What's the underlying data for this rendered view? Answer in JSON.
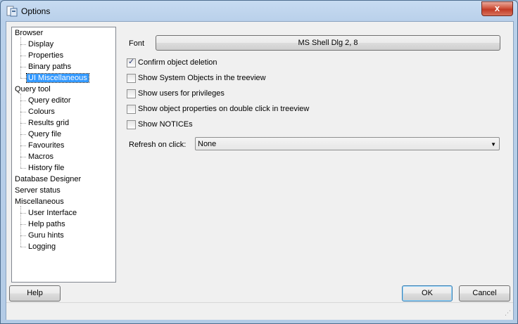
{
  "window": {
    "title": "Options",
    "close_glyph": "x"
  },
  "tree": {
    "items": [
      {
        "label": "Browser",
        "level": 0
      },
      {
        "label": "Display",
        "level": 1
      },
      {
        "label": "Properties",
        "level": 1
      },
      {
        "label": "Binary paths",
        "level": 1
      },
      {
        "label": "UI Miscellaneous",
        "level": 1,
        "selected": true
      },
      {
        "label": "Query tool",
        "level": 0
      },
      {
        "label": "Query editor",
        "level": 1
      },
      {
        "label": "Colours",
        "level": 1
      },
      {
        "label": "Results grid",
        "level": 1
      },
      {
        "label": "Query file",
        "level": 1
      },
      {
        "label": "Favourites",
        "level": 1
      },
      {
        "label": "Macros",
        "level": 1
      },
      {
        "label": "History file",
        "level": 1
      },
      {
        "label": "Database Designer",
        "level": 0
      },
      {
        "label": "Server status",
        "level": 0
      },
      {
        "label": "Miscellaneous",
        "level": 0
      },
      {
        "label": "User Interface",
        "level": 1
      },
      {
        "label": "Help paths",
        "level": 1
      },
      {
        "label": "Guru hints",
        "level": 1
      },
      {
        "label": "Logging",
        "level": 1
      }
    ]
  },
  "settings": {
    "font_label": "Font",
    "font_value": "MS Shell Dlg 2, 8",
    "checkboxes": [
      {
        "label": "Confirm object deletion",
        "checked": true
      },
      {
        "label": "Show System Objects in the treeview",
        "checked": false
      },
      {
        "label": "Show users for privileges",
        "checked": false
      },
      {
        "label": "Show object properties on double click in treeview",
        "checked": false
      },
      {
        "label": "Show NOTICEs",
        "checked": false
      }
    ],
    "refresh_label": "Refresh on click:",
    "refresh_value": "None"
  },
  "buttons": {
    "help": "Help",
    "ok": "OK",
    "cancel": "Cancel"
  }
}
